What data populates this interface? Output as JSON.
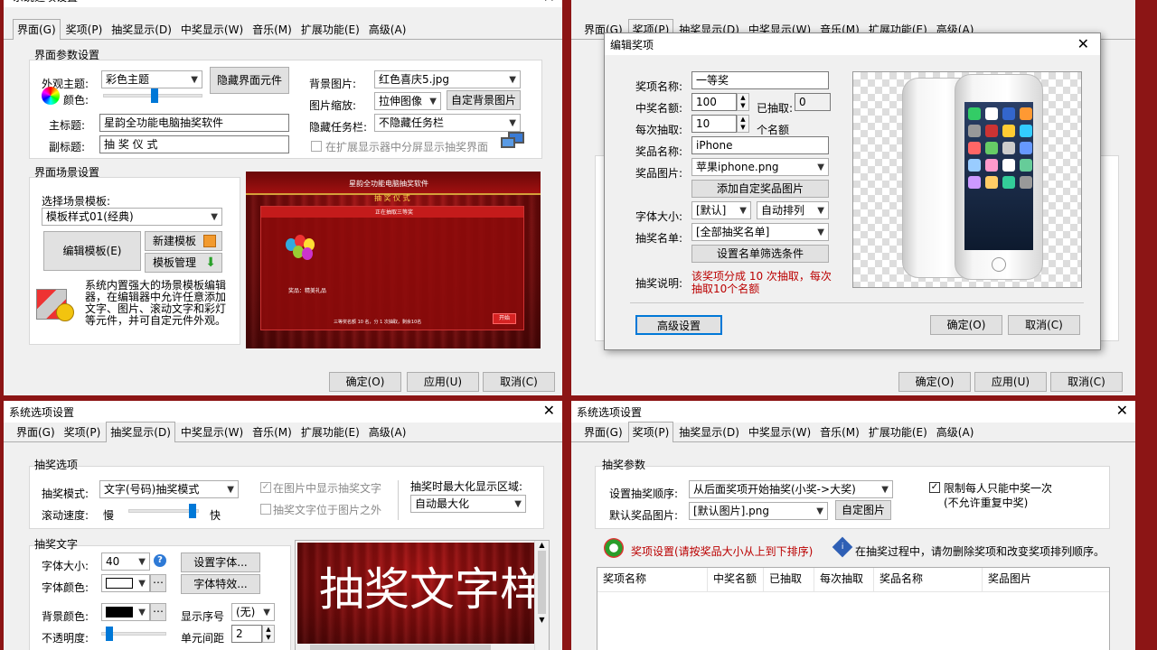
{
  "tabs": [
    "界面(G)",
    "奖项(P)",
    "抽奖显示(D)",
    "中奖显示(W)",
    "音乐(M)",
    "扩展功能(E)",
    "高级(A)"
  ],
  "window_title": "系统选项设置",
  "buttons": {
    "ok": "确定(O)",
    "apply": "应用(U)",
    "cancel": "取消(C)"
  },
  "q1": {
    "group1_title": "界面参数设置",
    "theme_label": "外观主题:",
    "theme_value": "彩色主题",
    "color_label": "颜色:",
    "hide_btn": "隐藏界面元件",
    "main_title_label": "主标题:",
    "main_title_value": "星韵全功能电脑抽奖软件",
    "sub_title_label": "副标题:",
    "sub_title_value": "抽 奖 仪 式",
    "bg_label": "背景图片:",
    "bg_value": "红色喜庆5.jpg",
    "scale_label": "图片缩放:",
    "scale_value": "拉伸图像",
    "custom_bg_btn": "自定背景图片",
    "taskbar_label": "隐藏任务栏:",
    "taskbar_value": "不隐藏任务栏",
    "split_screen": "在扩展显示器中分屏显示抽奖界面",
    "group2_title": "界面场景设置",
    "scene_label": "选择场景模板:",
    "scene_value": "模板样式01(经典)",
    "edit_tpl_btn": "编辑模板(E)",
    "new_tpl_btn": "新建模板",
    "manage_tpl_btn": "模板管理",
    "tpl_desc": "系统内置强大的场景模板编辑器，在编辑器中允许任意添加文字、图片、滚动文字和彩灯等元件，并可自定元件外观。",
    "preview_title": "星韵全功能电脑抽奖软件",
    "preview_sub": "抽 奖 仪 式",
    "preview_bar": "正在抽取三等奖",
    "preview_prize": "奖品：精美礼品",
    "preview_footer": "三等奖名额 10 名，分 1 次抽取，剩余10名",
    "preview_btn": "开始"
  },
  "q2": {
    "dialog_title": "编辑奖项",
    "prize_name_label": "奖项名称:",
    "prize_name_value": "一等奖",
    "winners_label": "中奖名额:",
    "winners_value": "100",
    "drawn_label": "已抽取:",
    "drawn_value": "0",
    "per_draw_label": "每次抽取:",
    "per_draw_value": "10",
    "per_draw_unit": "个名额",
    "item_name_label": "奖品名称:",
    "item_name_value": "iPhone",
    "item_img_label": "奖品图片:",
    "item_img_value": "苹果iphone.png",
    "add_img_btn": "添加自定奖品图片",
    "font_size_label": "字体大小:",
    "font_size_value": "[默认]",
    "arrange_value": "自动排列",
    "list_label": "抽奖名单:",
    "list_value": "[全部抽奖名单]",
    "filter_btn": "设置名单筛选条件",
    "desc_label": "抽奖说明:",
    "desc_value": "该奖项分成 10 次抽取，每次抽取10个名额",
    "advanced_btn": "高级设置",
    "ok": "确定(O)",
    "cancel": "取消(C)"
  },
  "q3": {
    "group1_title": "抽奖选项",
    "mode_label": "抽奖模式:",
    "mode_value": "文字(号码)抽奖模式",
    "speed_label": "滚动速度:",
    "speed_slow": "慢",
    "speed_fast": "快",
    "show_in_image": "在图片中显示抽奖文字",
    "text_outside": "抽奖文字位于图片之外",
    "maximize_label": "抽奖时最大化显示区域:",
    "maximize_value": "自动最大化",
    "group2_title": "抽奖文字",
    "font_size_label": "字体大小:",
    "font_size_value": "40",
    "set_font_btn": "设置字体...",
    "font_color_label": "字体颜色:",
    "font_effect_btn": "字体特效...",
    "bg_color_label": "背景颜色:",
    "serial_label": "显示序号",
    "serial_value": "(无)",
    "opacity_label": "不透明度:",
    "spacing_label": "单元间距",
    "spacing_value": "2",
    "preview_text": "抽奖文字样"
  },
  "q4": {
    "group_title": "抽奖参数",
    "order_label": "设置抽奖顺序:",
    "order_value": "从后面奖项开始抽奖(小奖->大奖)",
    "default_img_label": "默认奖品图片:",
    "default_img_value": "[默认图片].png",
    "custom_img_btn": "自定图片",
    "limit_once": "限制每人只能中奖一次",
    "no_repeat": "(不允许重复中奖)",
    "prize_settings": "奖项设置(请按奖品大小从上到下排序)",
    "warning": "在抽奖过程中，请勿删除奖项和改变奖项排列顺序。",
    "columns": [
      "奖项名称",
      "中奖名额",
      "已抽取",
      "每次抽取",
      "奖品名称",
      "奖品图片"
    ]
  },
  "colors": {
    "frame": "#8c1515",
    "accent": "#0078d7",
    "stage": "#a11212"
  }
}
